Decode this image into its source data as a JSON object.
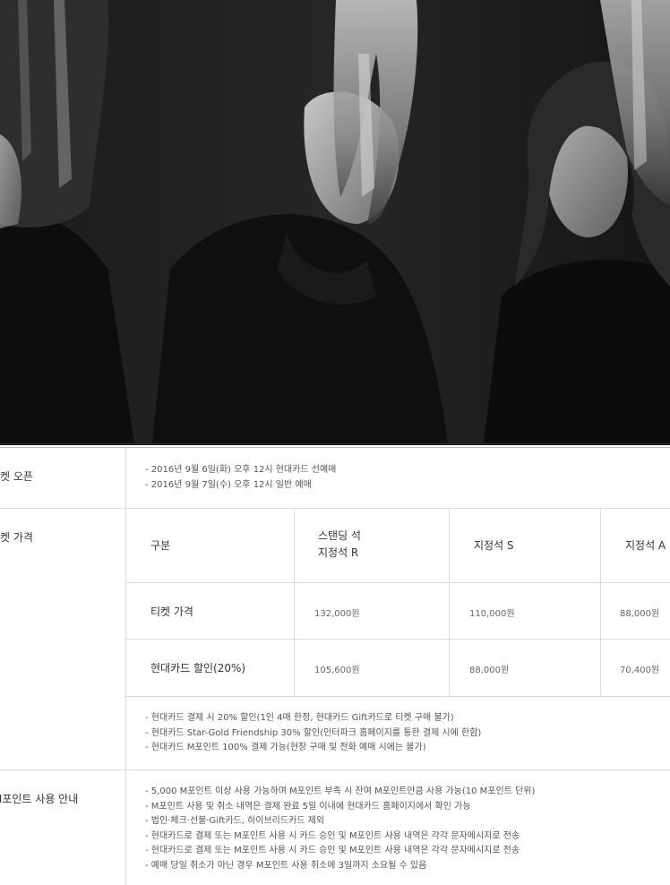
{
  "sections": {
    "open": {
      "label": "켓 오픈",
      "items": [
        "2016년 9월 6일(화) 오후 12시 현대카드 선예매",
        "2016년 9월 7일(수) 오후 12시 일반 예매"
      ]
    },
    "price": {
      "label": "켓 가격",
      "table": {
        "header": {
          "category": "구분",
          "col1_line1": "스탠딩 석",
          "col1_line2": "지정석 R",
          "col2": "지정석 S",
          "col3": "지정석 A"
        },
        "rows": [
          {
            "label": "티켓 가격",
            "values": [
              "132,000원",
              "110,000원",
              "88,000원"
            ]
          },
          {
            "label": "현대카드 할인(20%)",
            "values": [
              "105,600원",
              "88,000원",
              "70,400원"
            ]
          }
        ]
      },
      "notes": [
        "현대카드 결제 시 20% 할인(1인 4매 한정, 현대카드 Gift카드로 티켓 구매 불가)",
        "현대카드 Star-Gold Friendship 30% 할인(인터파크 홈페이지를 통한 결제 시에 한함)",
        "현대카드 M포인트 100% 결제 가능(현장 구매 및 전화 예매 시에는 불가)"
      ]
    },
    "mpoint": {
      "label": "M포인트 사용 안내",
      "items": [
        "5,000 M포인트 이상 사용 가능하며 M포인트 부족 시 잔여 M포인트만큼 사용 가능(10 M포인트 단위)",
        "M포인트 사용 및 취소 내역은 결제 완료 5일 이내에 현대카드 홈페이지에서 확인 가능",
        "법인·체크·선불·Gift카드, 하이브리드카드 제외",
        "현대카드로 결제 또는 M포인트 사용 시 카드 승인 및 M포인트 사용 내역은 각각 문자메시지로 전송",
        "현대카드로 결제 또는 M포인트 사용 시 카드 승인 및 M포인트 사용 내역은 각각 문자메시지로 전송",
        "예매 당일 취소가 아닌 경우 M포인트 사용 취소에 3일까지 소요될 수 있음"
      ]
    }
  }
}
